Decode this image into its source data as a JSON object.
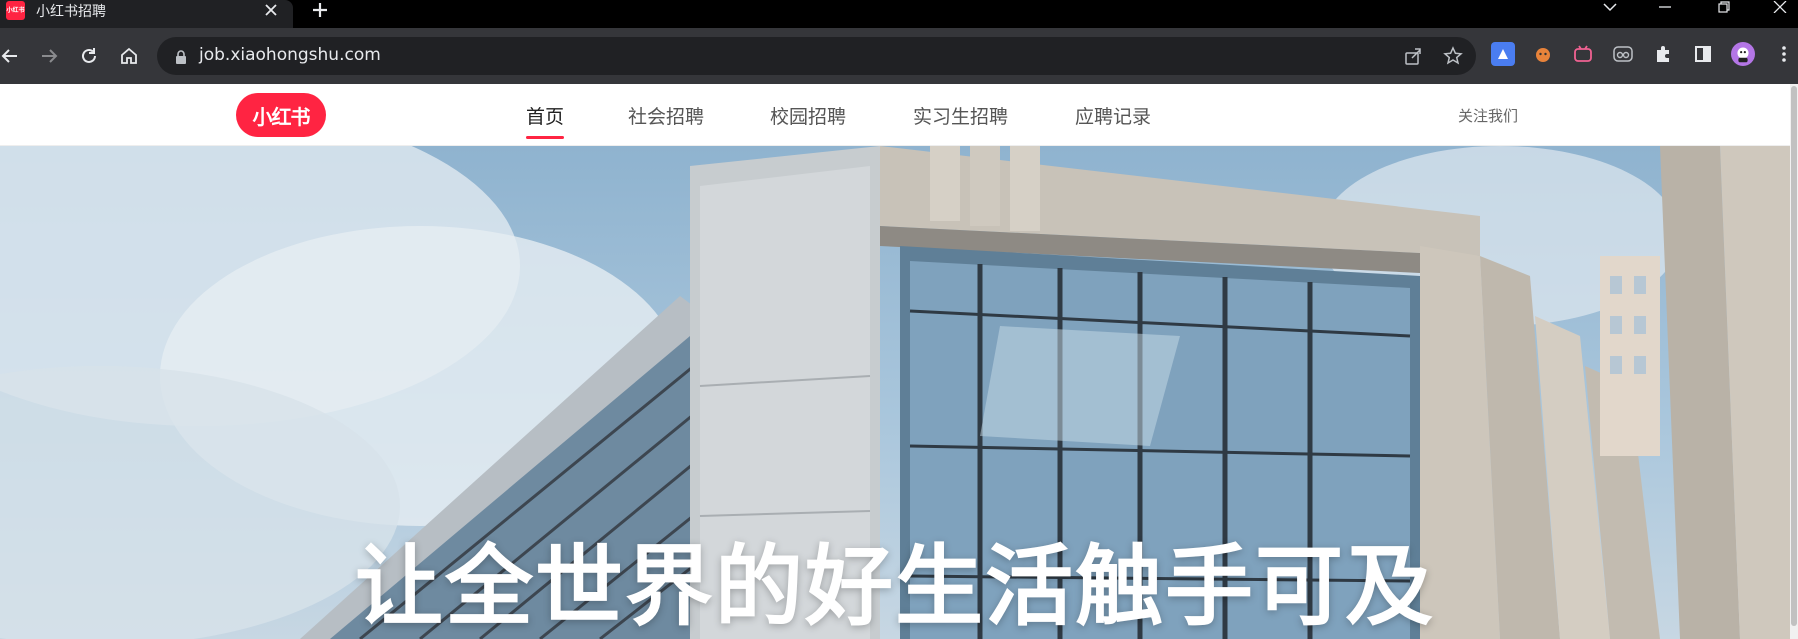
{
  "browser": {
    "tab": {
      "favicon_text": "小红书",
      "title": "小红书招聘"
    },
    "url": "job.xiaohongshu.com",
    "window_controls": [
      "chevron-down-icon",
      "minimize-icon",
      "restore-icon",
      "close-icon"
    ],
    "extensions": [
      "blue-ext-icon",
      "fox-ext-icon",
      "bilibili-ext-icon",
      "glasses-ext-icon",
      "puzzle-icon",
      "sidebar-icon",
      "avatar",
      "kebab-menu-icon"
    ]
  },
  "site": {
    "logo_text": "小红书",
    "nav": [
      {
        "label": "首页",
        "active": true
      },
      {
        "label": "社会招聘",
        "active": false
      },
      {
        "label": "校园招聘",
        "active": false
      },
      {
        "label": "实习生招聘",
        "active": false
      },
      {
        "label": "应聘记录",
        "active": false
      }
    ],
    "follow_label": "关注我们"
  },
  "hero": {
    "title": "让全世界的好生活触手可及"
  },
  "colors": {
    "brand": "#ff2442",
    "chrome_dark": "#202124",
    "chrome_toolbar": "#35363a"
  }
}
